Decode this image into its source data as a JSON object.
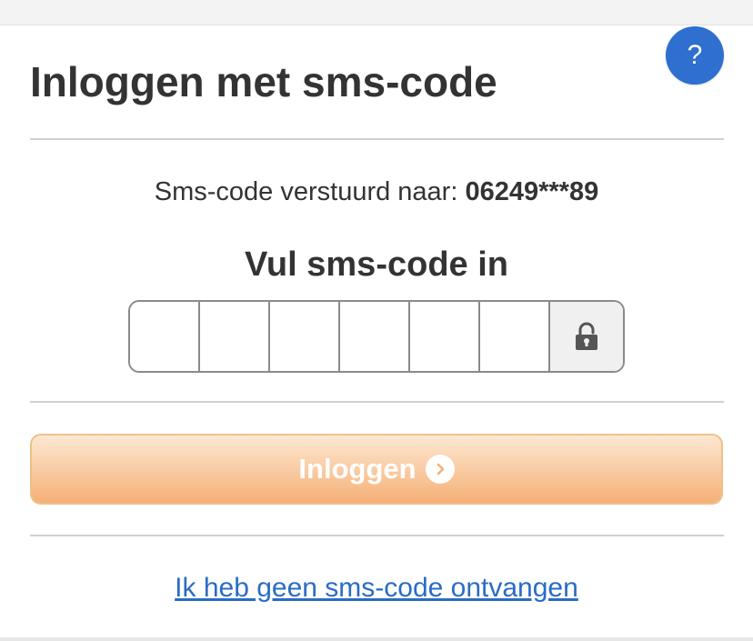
{
  "page": {
    "title": "Inloggen met sms-code",
    "help_label": "?"
  },
  "sms": {
    "sent_label": "Sms-code verstuurd naar:",
    "phone_masked": "06249***89"
  },
  "code_entry": {
    "label": "Vul sms-code in",
    "digits": [
      "",
      "",
      "",
      "",
      "",
      ""
    ],
    "lock_icon": "padlock-icon"
  },
  "actions": {
    "login_label": "Inloggen",
    "login_icon": "chevron-right-circle-icon",
    "no_code_link": "Ik heb geen sms-code ontvangen"
  },
  "colors": {
    "help_button": "#2f6fcf",
    "login_button": "#f5b077",
    "link": "#2a6cc4"
  }
}
